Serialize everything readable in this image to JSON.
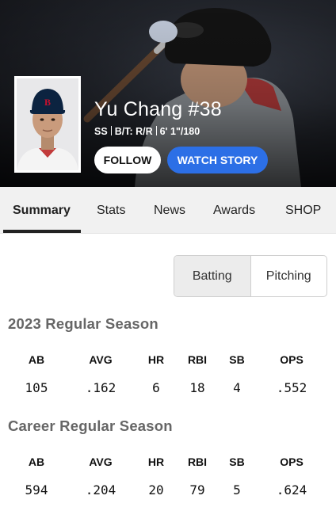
{
  "player": {
    "name": "Yu Chang #38",
    "position": "SS",
    "bats_throws": "B/T: R/R",
    "height_weight": "6' 1\"/180"
  },
  "actions": {
    "follow_label": "FOLLOW",
    "watch_label": "WATCH STORY"
  },
  "tabs": [
    {
      "label": "Summary",
      "active": true
    },
    {
      "label": "Stats",
      "active": false
    },
    {
      "label": "News",
      "active": false
    },
    {
      "label": "Awards",
      "active": false
    },
    {
      "label": "SHOP",
      "active": false
    }
  ],
  "toggle": {
    "options": [
      "Batting",
      "Pitching"
    ],
    "selected": "Batting"
  },
  "stat_columns": [
    "AB",
    "AVG",
    "HR",
    "RBI",
    "SB",
    "OPS"
  ],
  "seasons": [
    {
      "title": "2023 Regular Season",
      "values": [
        "105",
        ".162",
        "6",
        "18",
        "4",
        ".552"
      ]
    },
    {
      "title": "Career Regular Season",
      "values": [
        "594",
        ".204",
        "20",
        "79",
        "5",
        ".624"
      ]
    }
  ],
  "colors": {
    "watch_button": "#2c6fe6",
    "hero_dark": "#111216",
    "tab_bar": "#f1f1f1",
    "section_title": "#666666"
  },
  "icons": {
    "team_cap_logo": "red-sox-b-logo"
  }
}
